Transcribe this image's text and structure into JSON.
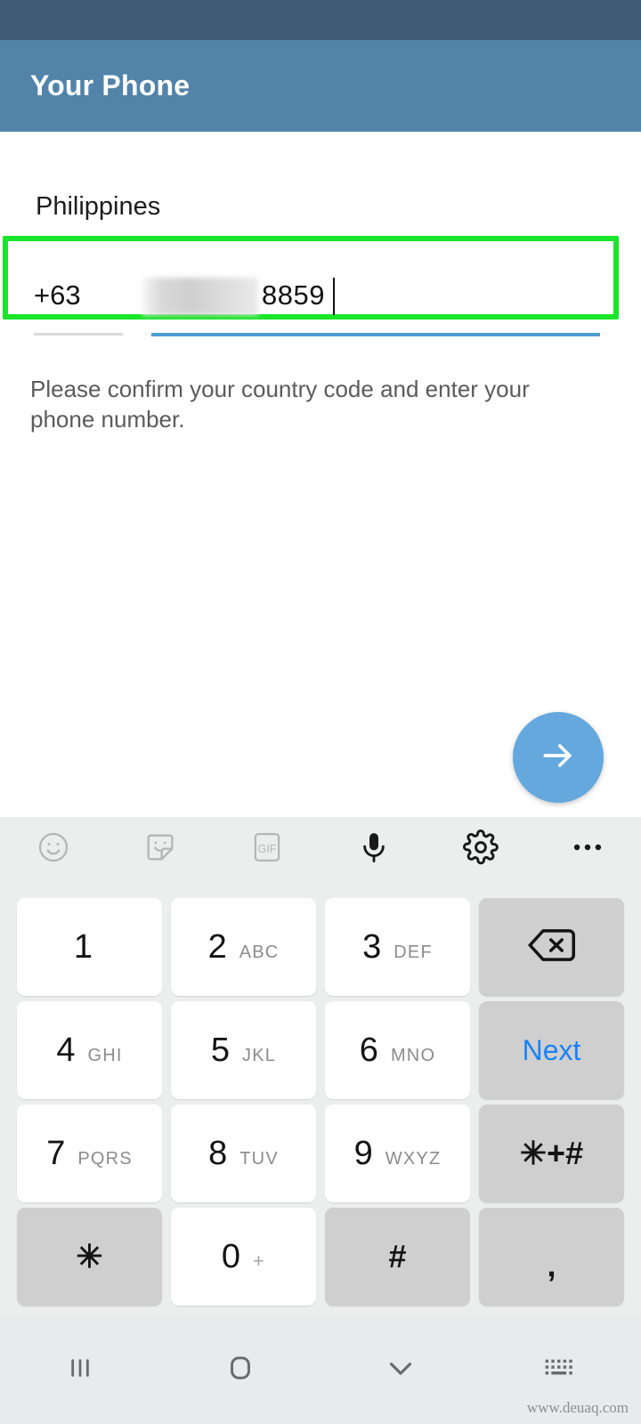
{
  "status_bar": {
    "color": "#3e5a75"
  },
  "app_bar": {
    "title": "Your Phone",
    "bg_color": "#5283a9",
    "text_color": "#ffffff"
  },
  "form": {
    "country_label": "Philippines",
    "country_code": "+63",
    "phone_number_visible": "8859",
    "phone_number_redacted": true,
    "hint": "Please confirm your country code and enter your phone number.",
    "highlight_color": "#19e52a",
    "active_underline_color": "#4f9cd4",
    "inactive_underline_color": "#dadada"
  },
  "fab": {
    "icon": "arrow-right-icon",
    "color": "#64a8dd"
  },
  "keyboard": {
    "bg_color": "#eceded",
    "toolbar": [
      {
        "name": "emoji-icon",
        "dim": true
      },
      {
        "name": "sticker-icon",
        "dim": true
      },
      {
        "name": "gif-icon",
        "dim": true,
        "label": "GIF"
      },
      {
        "name": "microphone-icon",
        "dim": false
      },
      {
        "name": "gear-icon",
        "dim": false
      },
      {
        "name": "overflow-menu-icon",
        "dim": false
      }
    ],
    "rows": [
      [
        {
          "digit": "1",
          "letters": "",
          "type": "digit"
        },
        {
          "digit": "2",
          "letters": "ABC",
          "type": "digit"
        },
        {
          "digit": "3",
          "letters": "DEF",
          "type": "digit"
        },
        {
          "icon": "backspace-icon",
          "type": "fn-icon"
        }
      ],
      [
        {
          "digit": "4",
          "letters": "GHI",
          "type": "digit"
        },
        {
          "digit": "5",
          "letters": "JKL",
          "type": "digit"
        },
        {
          "digit": "6",
          "letters": "MNO",
          "type": "digit"
        },
        {
          "label": "Next",
          "type": "fn-next"
        }
      ],
      [
        {
          "digit": "7",
          "letters": "PQRS",
          "type": "digit"
        },
        {
          "digit": "8",
          "letters": "TUV",
          "type": "digit"
        },
        {
          "digit": "9",
          "letters": "WXYZ",
          "type": "digit"
        },
        {
          "label": "✳+#",
          "type": "fn-sym"
        }
      ],
      [
        {
          "label": "✳",
          "type": "fn-sym"
        },
        {
          "digit": "0",
          "letters": "+",
          "type": "digit"
        },
        {
          "label": "#",
          "type": "fn-sym"
        },
        {
          "label": ",",
          "type": "fn-comma"
        }
      ]
    ]
  },
  "nav_bar": {
    "bg_color": "#e9eaeb",
    "items": [
      {
        "name": "recents-icon"
      },
      {
        "name": "home-icon"
      },
      {
        "name": "hide-keyboard-chevron-icon"
      },
      {
        "name": "keyboard-switch-icon"
      }
    ]
  },
  "watermark": "www.deuaq.com"
}
